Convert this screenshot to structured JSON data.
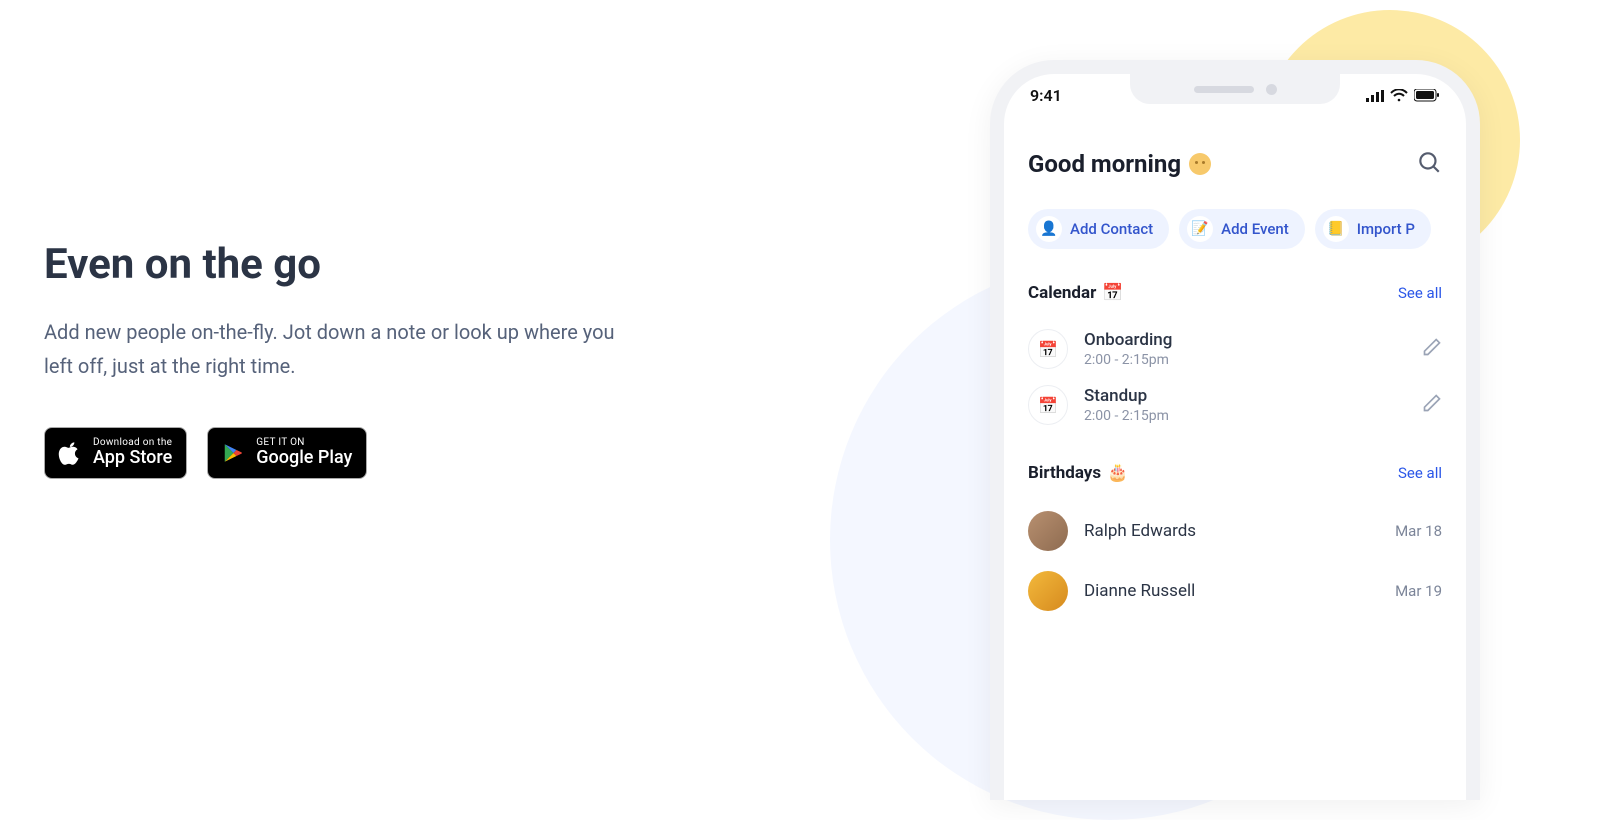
{
  "left": {
    "heading": "Even on the go",
    "paragraph": "Add new people on-the-fly. Jot down a note or look up where you left off, just at the right time.",
    "appstore": {
      "small": "Download on the",
      "big": "App Store"
    },
    "play": {
      "small": "GET IT ON",
      "big": "Google Play"
    }
  },
  "phone": {
    "time": "9:41",
    "greeting": "Good morning",
    "chips": {
      "add_contact": "Add Contact",
      "add_event": "Add Event",
      "import": "Import P"
    },
    "calendar": {
      "title": "Calendar",
      "see_all": "See all",
      "events": [
        {
          "title": "Onboarding",
          "time": "2:00 - 2:15pm"
        },
        {
          "title": "Standup",
          "time": "2:00 - 2:15pm"
        }
      ]
    },
    "birthdays": {
      "title": "Birthdays",
      "see_all": "See all",
      "people": [
        {
          "name": "Ralph Edwards",
          "date": "Mar 18"
        },
        {
          "name": "Dianne Russell",
          "date": "Mar 19"
        }
      ]
    }
  }
}
